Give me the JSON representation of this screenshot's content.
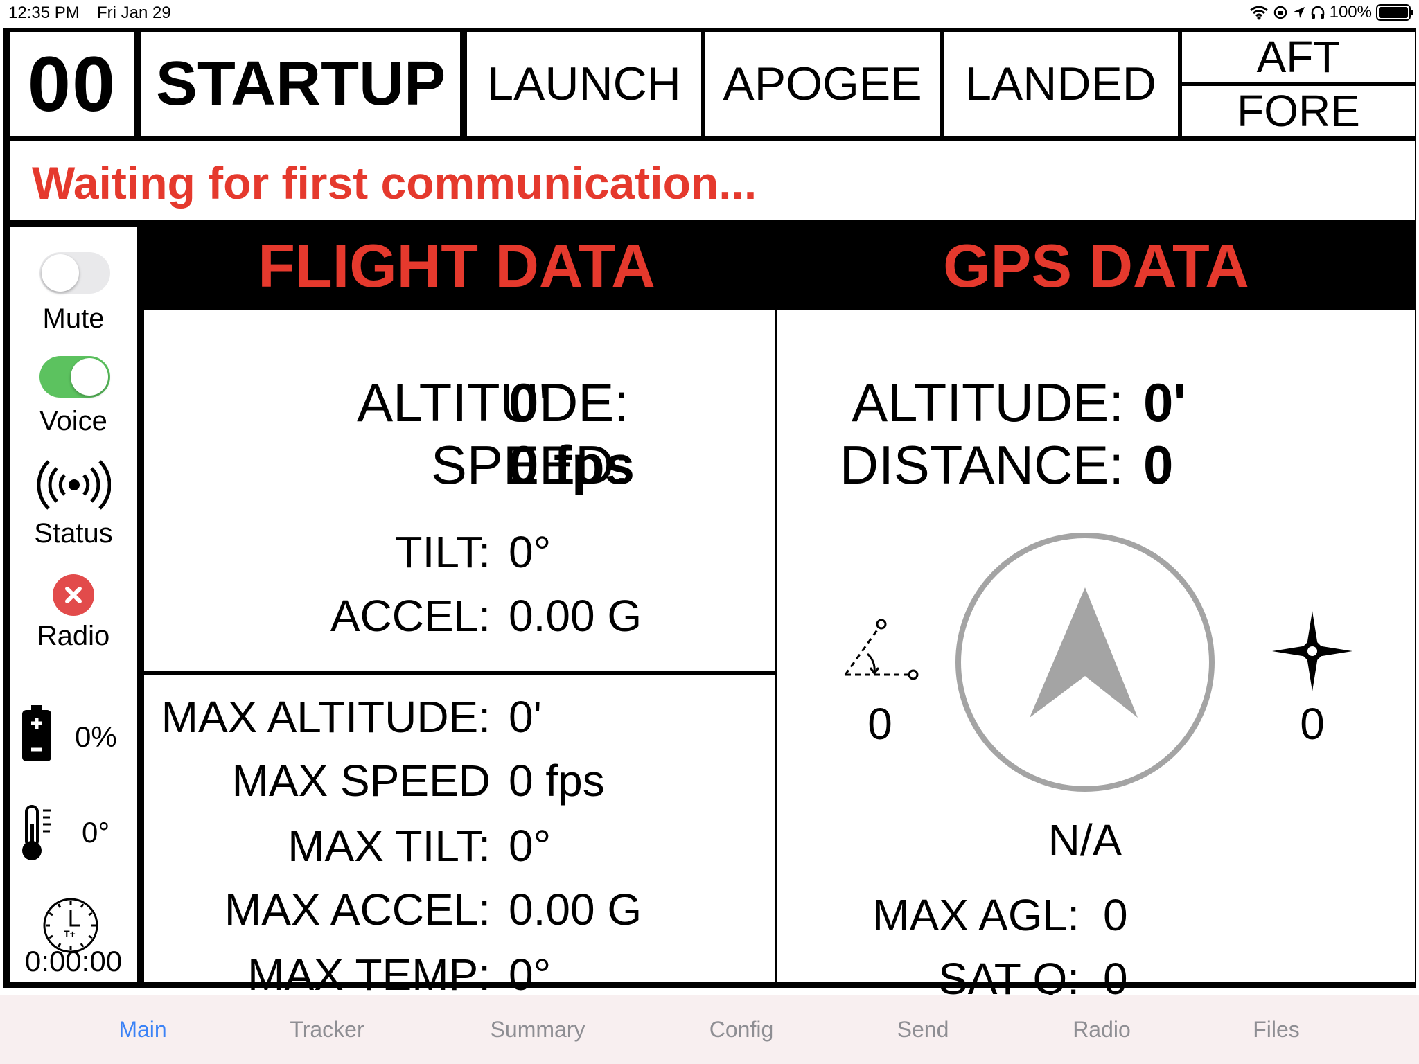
{
  "status_bar": {
    "time": "12:35 PM",
    "date": "Fri Jan 29",
    "battery": "100%"
  },
  "header": {
    "counter": "00",
    "phases": {
      "startup": "STARTUP",
      "launch": "LAUNCH",
      "apogee": "APOGEE",
      "landed": "LANDED"
    },
    "aft": "AFT",
    "fore": "FORE"
  },
  "message": "Waiting for first communication...",
  "sidebar": {
    "mute_label": "Mute",
    "mute_on": false,
    "voice_label": "Voice",
    "voice_on": true,
    "status_label": "Status",
    "radio_label": "Radio",
    "battery_value": "0%",
    "temp_value": "0°",
    "timer_value": "0:00:00",
    "timer_icon_text": "T+",
    "colors": {
      "toggle_on": "#5cc25f",
      "radio_error": "#e24b4b"
    }
  },
  "flight": {
    "title": "FLIGHT DATA",
    "altitude_label": "ALTITUDE:",
    "altitude_value": "0'",
    "speed_label": "SPEED:",
    "speed_value": "0 fps",
    "tilt_label": "TILT:",
    "tilt_value": "0°",
    "accel_label": "ACCEL:",
    "accel_value": "0.00 G",
    "max_altitude_label": "MAX ALTITUDE:",
    "max_altitude_value": "0'",
    "max_speed_label": "MAX SPEED",
    "max_speed_value": "0 fps",
    "max_tilt_label": "MAX TILT:",
    "max_tilt_value": "0°",
    "max_accel_label": "MAX ACCEL:",
    "max_accel_value": "0.00 G",
    "max_temp_label": "MAX TEMP:",
    "max_temp_value": "0°"
  },
  "gps": {
    "title": "GPS DATA",
    "altitude_label": "ALTITUDE:",
    "altitude_value": "0'",
    "distance_label": "DISTANCE:",
    "distance_value": "0",
    "angle_value": "0",
    "bearing_value": "0",
    "compass_text": "N/A",
    "max_agl_label": "MAX AGL:",
    "max_agl_value": "0",
    "sat_q_label": "SAT Q:",
    "sat_q_value": "0"
  },
  "colors": {
    "accent_red": "#e5392d",
    "tab_active": "#3b82f6",
    "tab_inactive": "#8e8e93",
    "tabbar_bg": "#f8eff0"
  },
  "tabs": [
    {
      "label": "Main",
      "active": true
    },
    {
      "label": "Tracker",
      "active": false
    },
    {
      "label": "Summary",
      "active": false
    },
    {
      "label": "Config",
      "active": false
    },
    {
      "label": "Send",
      "active": false
    },
    {
      "label": "Radio",
      "active": false
    },
    {
      "label": "Files",
      "active": false
    }
  ]
}
